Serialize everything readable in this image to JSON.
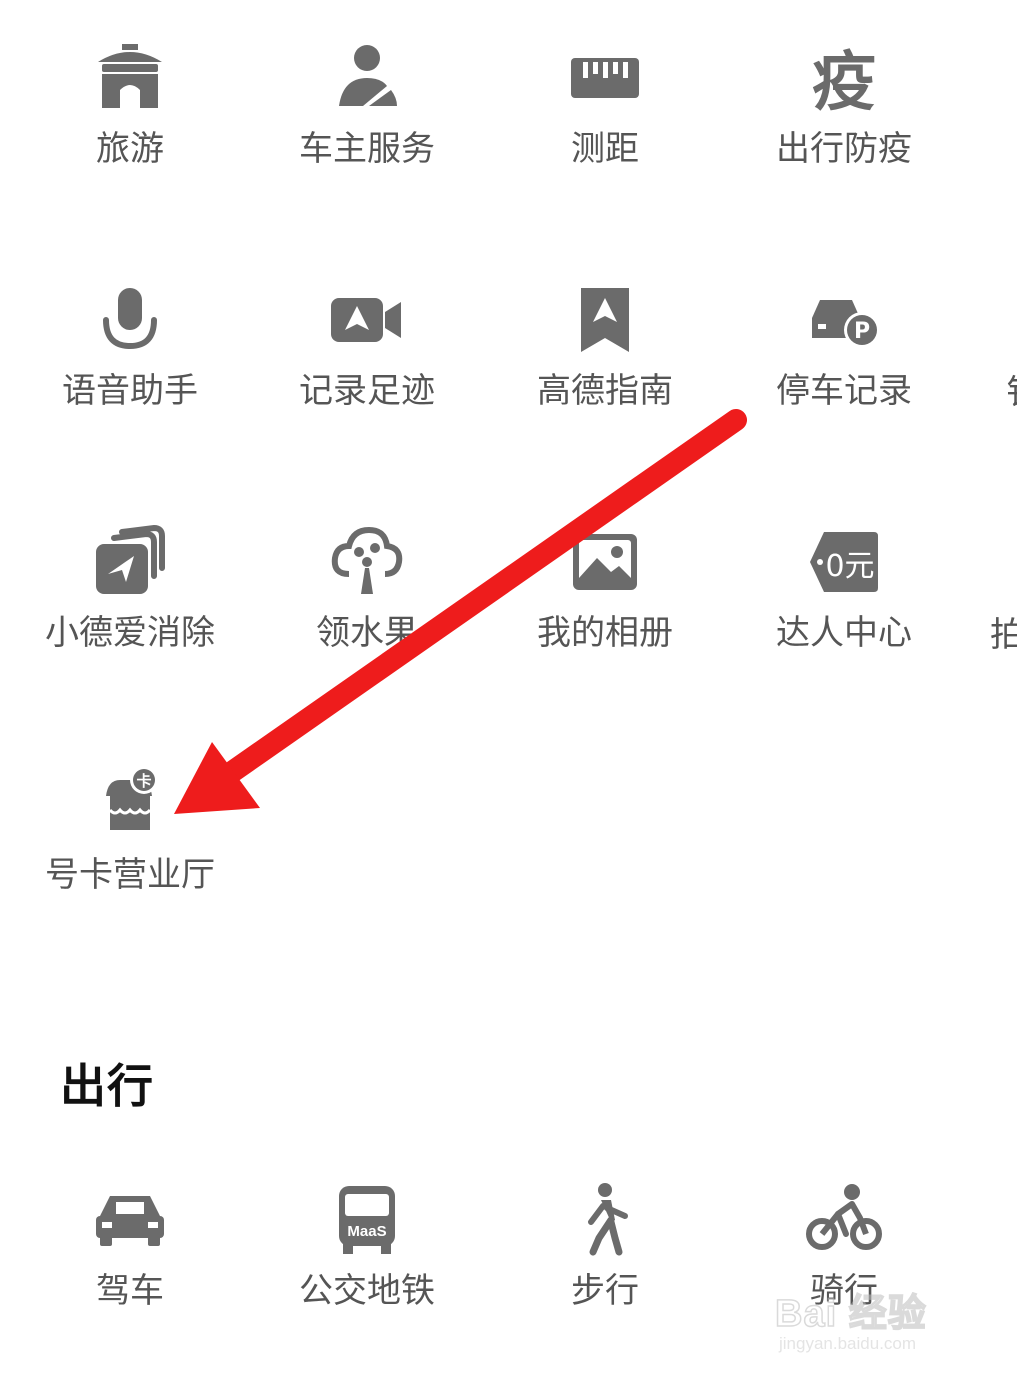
{
  "grid": {
    "row1": [
      "旅游",
      "车主服务",
      "测距",
      "出行防疫"
    ],
    "row2": [
      "语音助手",
      "记录足迹",
      "高德指南",
      "停车记录"
    ],
    "row3": [
      "小德爱消除",
      "领水果",
      "我的相册",
      "达人中心"
    ],
    "row4": [
      "号卡营业厅"
    ],
    "partial_right": [
      "钅",
      "拍"
    ]
  },
  "icons": {
    "epidemic_char": "疫",
    "coupon_text": "0元",
    "maas_text": "MaaS",
    "card_badge": "卡",
    "parking_badge": "P"
  },
  "travel_section": {
    "title": "出行",
    "items": [
      "驾车",
      "公交地铁",
      "步行",
      "骑行"
    ]
  },
  "colors": {
    "icon": "#6b6b6b",
    "label": "#555555",
    "title": "#111111",
    "arrow": "#ee1c1c"
  },
  "watermark": {
    "brand": "Bai 经验",
    "url": "jingyan.baidu.com"
  }
}
